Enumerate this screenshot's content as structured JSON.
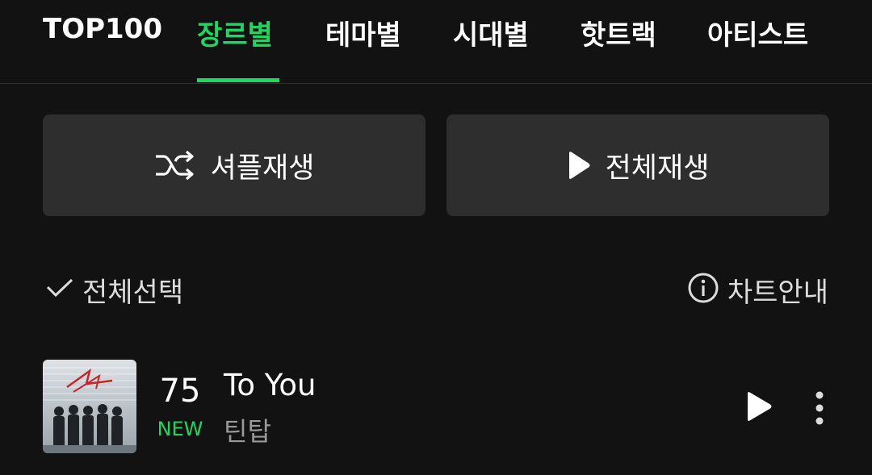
{
  "tabs": [
    {
      "label": "TOP100"
    },
    {
      "label": "장르별",
      "active": true
    },
    {
      "label": "테마별"
    },
    {
      "label": "시대별"
    },
    {
      "label": "핫트랙"
    },
    {
      "label": "아티스트"
    }
  ],
  "actions": {
    "shuffle_label": "셔플재생",
    "play_all_label": "전체재생"
  },
  "list_header": {
    "select_all_label": "전체선택",
    "chart_info_label": "차트안내"
  },
  "tracks": [
    {
      "rank": "75",
      "badge": "NEW",
      "title": "To You",
      "artist": "틴탑"
    }
  ],
  "colors": {
    "background": "#121212",
    "accent": "#1ed760",
    "button_bg": "#2e2e2e",
    "secondary_text": "#9a9a9a"
  },
  "icons": {
    "shuffle": "shuffle-icon",
    "play_all": "play-icon",
    "select_all": "check-icon",
    "chart_info": "info-icon",
    "track_play": "play-icon",
    "track_more": "more-vertical-icon"
  }
}
